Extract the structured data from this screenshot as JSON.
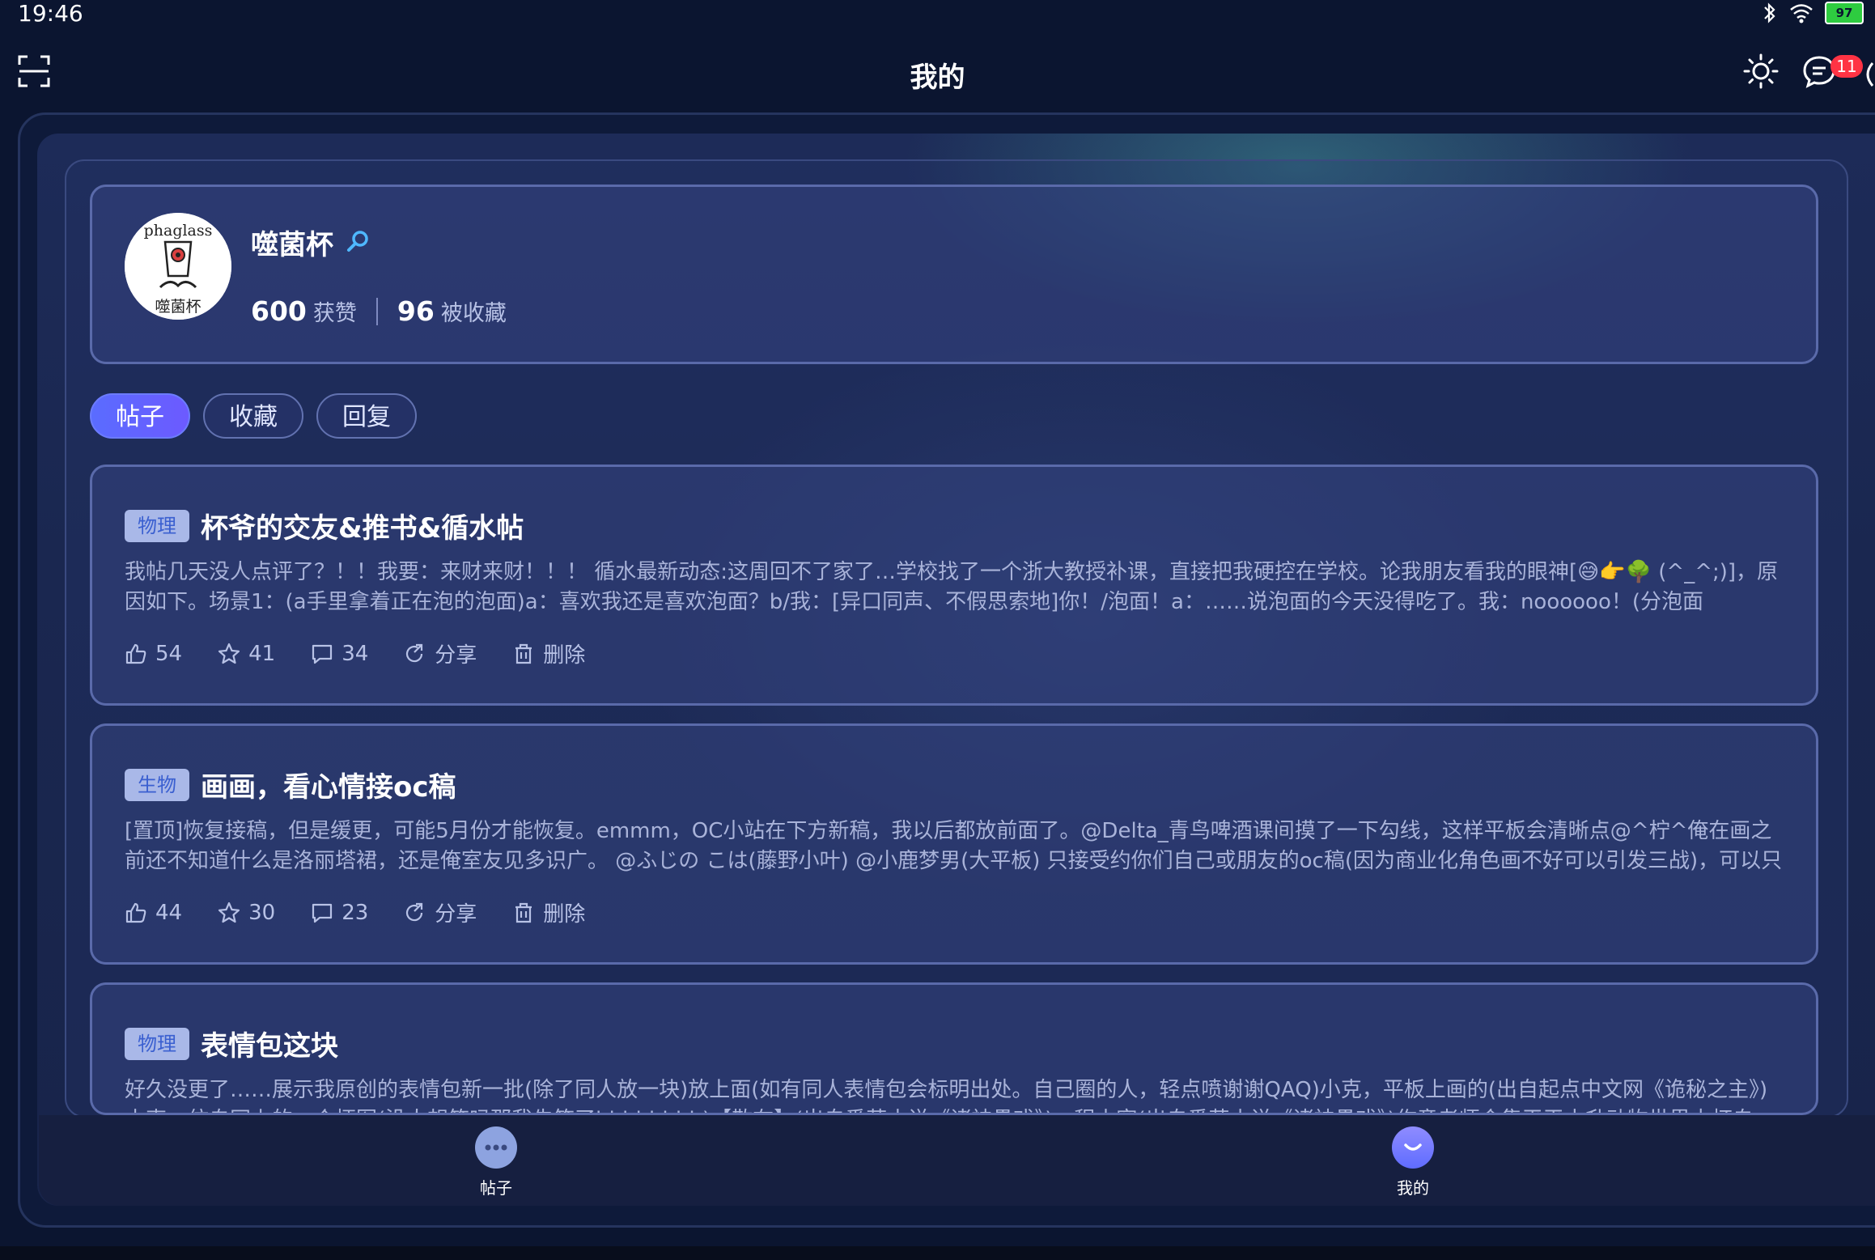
{
  "status": {
    "time": "19:46",
    "battery": "97"
  },
  "header": {
    "title": "我的",
    "badge": "11"
  },
  "profile": {
    "avatar_text_top": "phaglass",
    "avatar_text_bottom": "噬菌杯",
    "name": "噬菌杯",
    "likes": "600",
    "likes_label": "获赞",
    "favorites": "96",
    "favorites_label": "被收藏"
  },
  "tabs": [
    {
      "label": "帖子",
      "active": true
    },
    {
      "label": "收藏",
      "active": false
    },
    {
      "label": "回复",
      "active": false
    }
  ],
  "posts": [
    {
      "tag": "物理",
      "title": "杯爷的交友&推书&循水帖",
      "body": "我帖几天没人点评了？！！我要：来财来财！！！ 循水最新动态:这周回不了家了…学校找了一个浙大教授补课，直接把我硬控在学校。论我朋友看我的眼神[😅👉🌳 (^_^;)]，原因如下。场景1：(a手里拿着正在泡的泡面)a：喜欢我还是喜欢泡面？b/我：[异口同声、不假思索地]你！/泡面！a：……说泡面的今天没得吃了。我：noooooo！(分泡面ing……)c：下…",
      "likes": "54",
      "stars": "41",
      "comments": "34",
      "share": "分享",
      "delete": "删除"
    },
    {
      "tag": "生物",
      "title": "画画，看心情接oc稿",
      "body": "[置顶]恢复接稿，但是缓更，可能5月份才能恢复。emmm，OC小站在下方新稿，我以后都放前面了。@Delta_青鸟啤酒课间摸了一下勾线，这样平板会清晰点@^柠^俺在画之前还不知道什么是洛丽塔裙，还是俺室友见多识广。 @ふじの こは(藤野小叶) @小鹿梦男(大平板) 只接受约你们自己或朋友的oc稿(因为商业化角色画不好可以引发三战)，可以只文…",
      "likes": "44",
      "stars": "30",
      "comments": "23",
      "share": "分享",
      "delete": "删除"
    },
    {
      "tag": "物理",
      "title": "表情包这块",
      "body": "好久没更了……展示我原创的表情包新一批(除了同人放一块)放上面(如有同人表情包会标明出处。自己圈的人，轻点喷谢谢QAQ)小克，平板上画的(出自起点中文网《诡秘之主》)小克，仿自网上的一个梗图(没人想笑吗那我先笑了hhhhhhhh)【散布】(出自番茄小说《诸神愚戏》)，程小宽(出自番茄小说《诸神愚戏》)作意老师会集平平小升动物世界本杯自己…"
    }
  ],
  "bottom_nav": [
    {
      "label": "帖子"
    },
    {
      "label": "我的"
    }
  ]
}
